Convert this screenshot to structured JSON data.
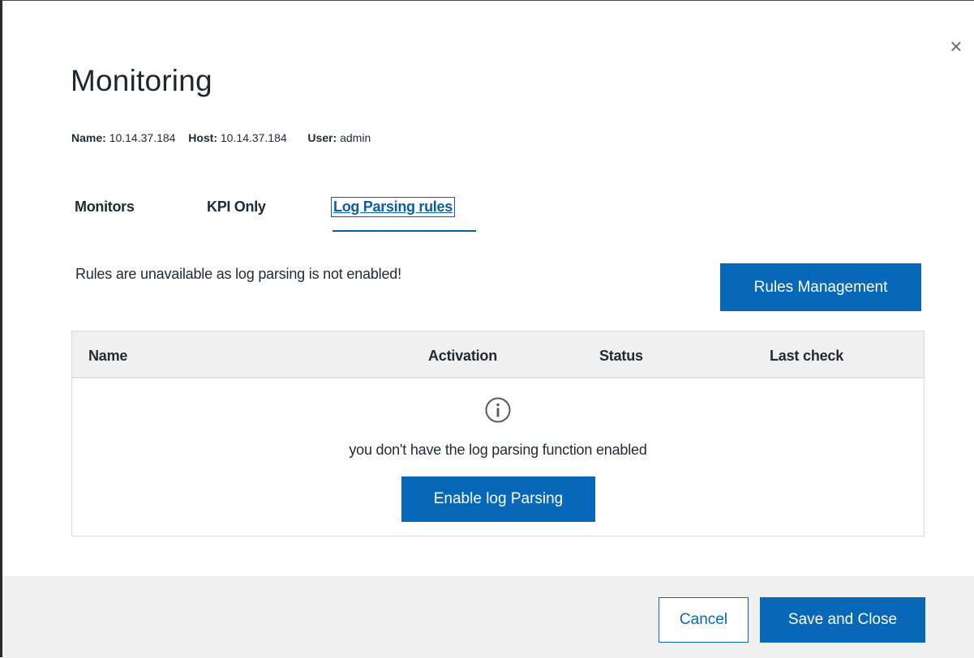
{
  "dialog": {
    "title": "Monitoring",
    "close_glyph": "×",
    "close_icon": "close-icon"
  },
  "meta": {
    "name_label": "Name:",
    "name_value": "10.14.37.184",
    "host_label": "Host:",
    "host_value": "10.14.37.184",
    "user_label": "User:",
    "user_value": "admin"
  },
  "tabs": [
    {
      "label": "Monitors",
      "active": false
    },
    {
      "label": "KPI Only",
      "active": false
    },
    {
      "label": "Log Parsing rules",
      "active": true
    }
  ],
  "notice": "Rules are unavailable as log parsing is not enabled!",
  "rules_button": "Rules Management",
  "table": {
    "columns": [
      "Name",
      "Activation",
      "Status",
      "Last check"
    ],
    "empty_icon": "info-icon",
    "empty_message": "you don't have the log parsing function enabled",
    "enable_button": "Enable log Parsing"
  },
  "footer": {
    "cancel": "Cancel",
    "save": "Save and Close"
  },
  "colors": {
    "primary": "#0767b8",
    "tab_active": "#0a5ea8",
    "header_bg": "#f0f0f0"
  }
}
